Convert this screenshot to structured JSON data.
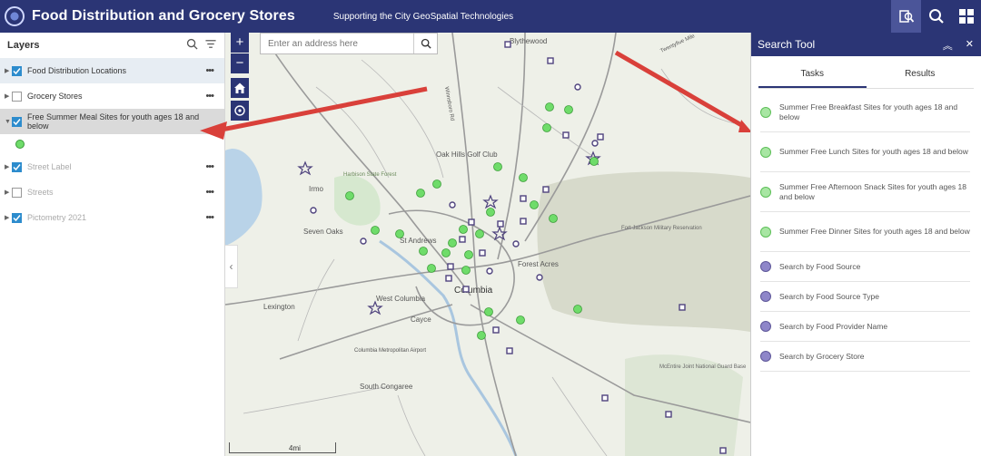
{
  "header": {
    "title": "Food Distribution and Grocery Stores",
    "subtitle": "Supporting the City GeoSpatial Technologies"
  },
  "layers": {
    "title": "Layers",
    "items": [
      {
        "label": "Food Distribution Locations",
        "checked": true
      },
      {
        "label": "Grocery Stores",
        "checked": false
      },
      {
        "label": "Free Summer Meal Sites for youth ages 18 and below",
        "checked": true
      },
      {
        "label": "Street Label",
        "checked": true
      },
      {
        "label": "Streets",
        "checked": false
      },
      {
        "label": "Pictometry 2021",
        "checked": true
      }
    ]
  },
  "search": {
    "placeholder": "Enter an address here"
  },
  "map": {
    "places": [
      "Blythewood",
      "Oak Hills Golf Club",
      "Harbison State Forest",
      "Irmo",
      "Seven Oaks",
      "St Andrews",
      "Forest Acres",
      "Fort Jackson Military Reservation",
      "West Columbia",
      "Cayce",
      "Columbia",
      "Lexington",
      "Columbia Metropolitan Airport",
      "South Congaree",
      "McEntire Joint National Guard Base",
      "Winnsboro Rd",
      "Twentyfive Mile"
    ],
    "scale": "4mi"
  },
  "panel": {
    "title": "Search Tool",
    "tabs": [
      "Tasks",
      "Results"
    ],
    "tasks": [
      {
        "label": "Summer Free Breakfast Sites for youth ages 18 and below",
        "color": "green"
      },
      {
        "label": "Summer Free Lunch Sites for youth ages 18 and below",
        "color": "green"
      },
      {
        "label": "Summer Free Afternoon Snack Sites for youth ages 18 and below",
        "color": "green"
      },
      {
        "label": "Summer Free Dinner Sites for youth ages 18 and below",
        "color": "green"
      },
      {
        "label": "Search by Food Source",
        "color": "purple"
      },
      {
        "label": "Search by Food Source Type",
        "color": "purple"
      },
      {
        "label": "Search by Food Provider Name",
        "color": "purple"
      },
      {
        "label": "Search by Grocery Store",
        "color": "purple"
      }
    ]
  },
  "colors": {
    "brand": "#2b3575",
    "accent": "#2d8ccd",
    "meal_site": "#6fdc6a",
    "food_site": "#5e4f8e",
    "arrow": "#d9403a"
  }
}
